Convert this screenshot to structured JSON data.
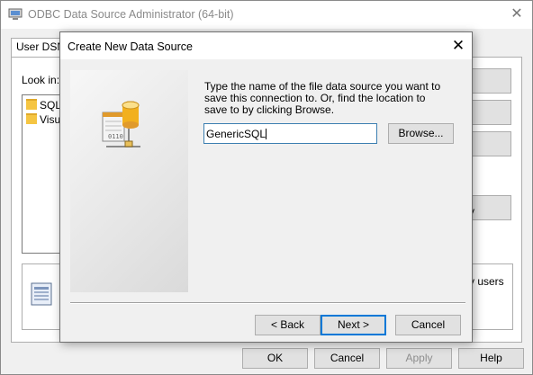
{
  "background_window": {
    "title": "ODBC Data Source Administrator (64-bit)",
    "tab": "User DSN",
    "look_in_label": "Look in:",
    "folders": [
      "SQL",
      "Visua"
    ],
    "info_text": "y users",
    "side_button_text": "y",
    "buttons": {
      "ok": "OK",
      "cancel": "Cancel",
      "apply": "Apply",
      "help": "Help"
    }
  },
  "dialog": {
    "title": "Create New Data Source",
    "instruction": "Type the name of the file data source you want to save this connection to.  Or, find the location to save to by clicking Browse.",
    "filename_value": "GenericSQL",
    "browse_button": "Browse...",
    "back_button": "< Back",
    "next_button": "Next >",
    "cancel_button": "Cancel",
    "graphic_label": "0110"
  },
  "icons": [
    "odbc-app-icon",
    "close-icon",
    "folder-icon",
    "data-source-icon",
    "database-icon"
  ],
  "colors": {
    "input_focus_border": "#3c7fb1",
    "default_button_border": "#0078d7",
    "database_gold": "#f2b01e"
  }
}
